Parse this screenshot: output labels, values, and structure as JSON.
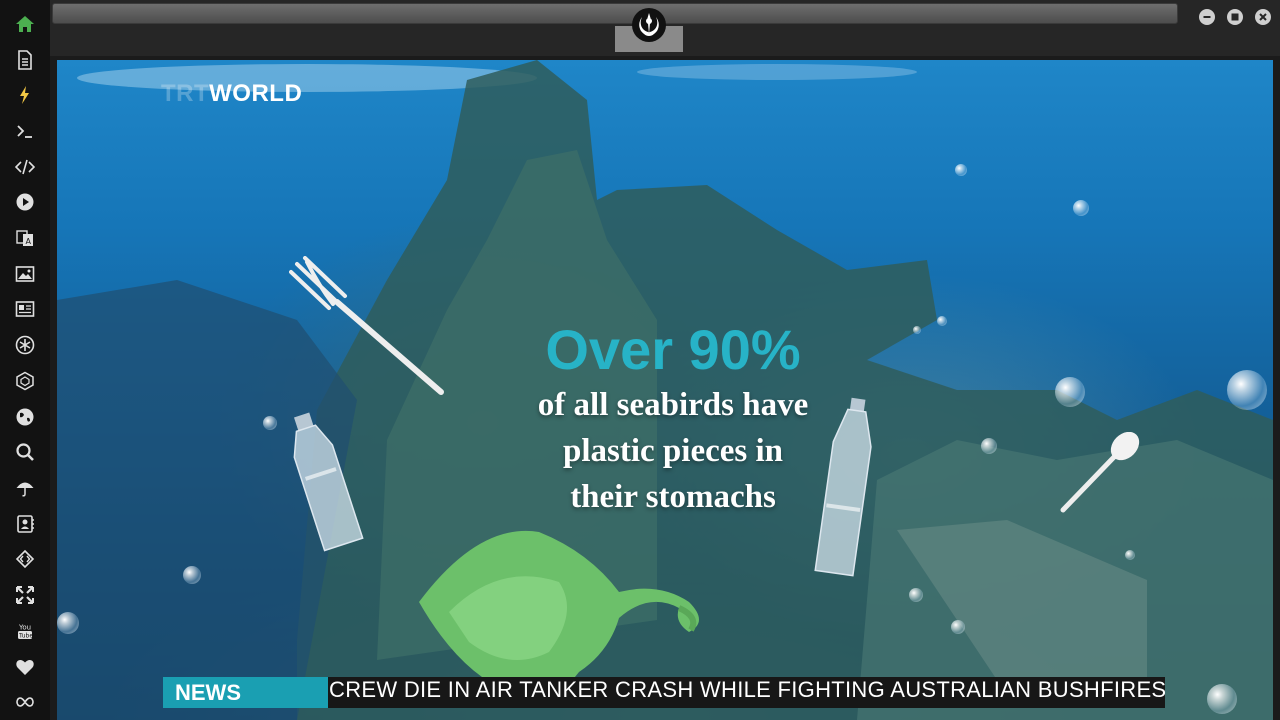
{
  "sidebar": {
    "items": [
      {
        "icon": "home-icon",
        "color": "#4caf50"
      },
      {
        "icon": "document-icon",
        "color": "#e0e0e0"
      },
      {
        "icon": "lightning-icon",
        "color": "#f2c744"
      },
      {
        "icon": "terminal-icon",
        "color": "#e0e0e0"
      },
      {
        "icon": "code-icon",
        "color": "#e0e0e0"
      },
      {
        "icon": "play-icon",
        "color": "#e0e0e0"
      },
      {
        "icon": "translate-icon",
        "color": "#e0e0e0"
      },
      {
        "icon": "image-icon",
        "color": "#e0e0e0"
      },
      {
        "icon": "newspaper-icon",
        "color": "#e0e0e0"
      },
      {
        "icon": "asterisk-icon",
        "color": "#e0e0e0"
      },
      {
        "icon": "cube-icon",
        "color": "#e0e0e0"
      },
      {
        "icon": "globe-icon",
        "color": "#e0e0e0"
      },
      {
        "icon": "search-icon",
        "color": "#e0e0e0"
      },
      {
        "icon": "umbrella-icon",
        "color": "#e0e0e0"
      },
      {
        "icon": "contacts-icon",
        "color": "#e0e0e0"
      },
      {
        "icon": "diamond-code-icon",
        "color": "#e0e0e0"
      },
      {
        "icon": "expand-icon",
        "color": "#e0e0e0"
      },
      {
        "icon": "youtube-icon",
        "color": "#e0e0e0"
      },
      {
        "icon": "heart-icon",
        "color": "#e0e0e0"
      },
      {
        "icon": "infinity-icon",
        "color": "#e0e0e0"
      }
    ],
    "youtube_text": "You\nTube"
  },
  "video": {
    "logo": {
      "brand": "TRT",
      "name": "WORLD"
    },
    "headline": {
      "big": "Over 90%",
      "line1": "of all seabirds have",
      "line2": "plastic pieces in",
      "line3": "their stomachs"
    },
    "ticker": {
      "label": "NEWS",
      "text": "CREW DIE IN AIR TANKER CRASH WHILE FIGHTING AUSTRALIAN BUSHFIRES"
    }
  },
  "colors": {
    "accent": "#27b3c7",
    "ticker_label": "#1a9fb2"
  }
}
